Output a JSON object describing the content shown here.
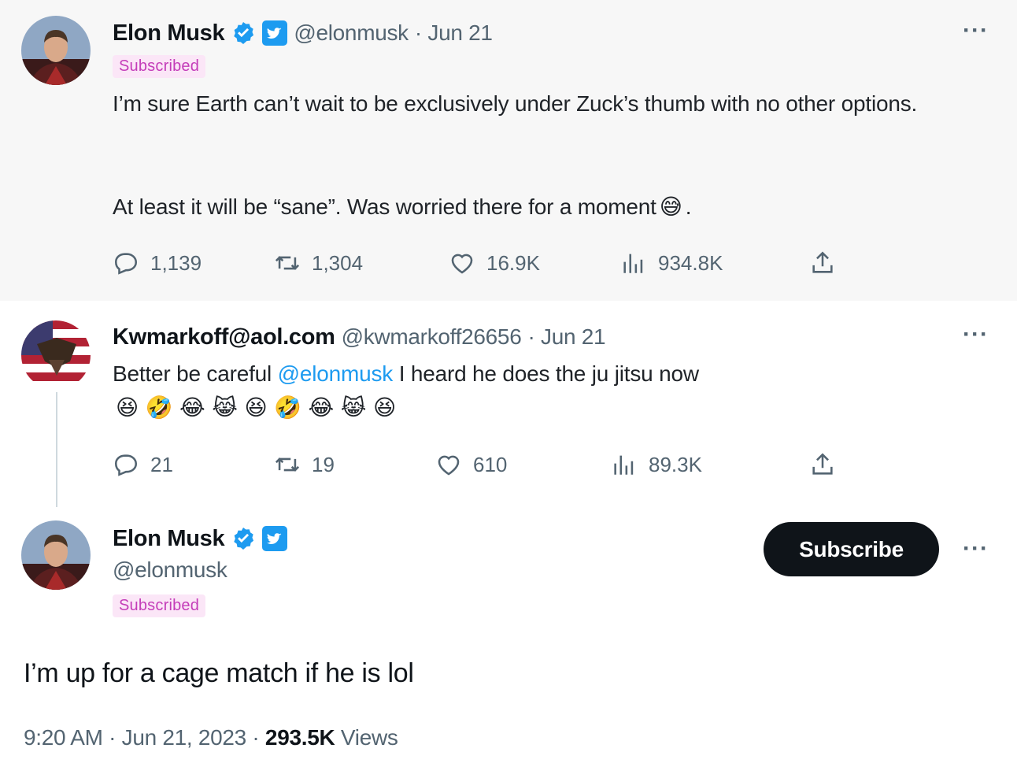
{
  "tweet1": {
    "name": "Elon Musk",
    "handle": "@elonmusk",
    "date": "· Jun 21",
    "subscribed": "Subscribed",
    "text_line1": "I’m sure Earth can’t wait to be exclusively under Zuck’s thumb with no other options.",
    "text_line2": "At least it will be “sane”. Was worried there for a moment",
    "text_end_emoji": "😅",
    "text_end": ".",
    "more": "···",
    "replies": "1,139",
    "retweets": "1,304",
    "likes": "16.9K",
    "views": "934.8K"
  },
  "tweet2": {
    "name": "Kwmarkoff@aol.com",
    "handle": "@kwmarkoff26656",
    "date": "· Jun 21",
    "text_before": "Better be careful ",
    "mention": "@elonmusk",
    "text_after": " I heard he does the ju jitsu now",
    "emojis": "😆 🤣 😂 😹 😆 🤣 😂 😹 😆",
    "more": "···",
    "replies": "21",
    "retweets": "19",
    "likes": "610",
    "views": "89.3K"
  },
  "tweet3": {
    "name": "Elon Musk",
    "handle": "@elonmusk",
    "subscribed": "Subscribed",
    "subscribe_button": "Subscribe",
    "more": "···",
    "text": "I’m up for a cage match if he is lol",
    "time": "9:20 AM · Jun 21, 2023 · ",
    "views_count": "293.5K",
    "views_label": " Views"
  },
  "icons": {
    "verified": "verified-check-icon",
    "twitter_badge": "twitter-bird-icon",
    "reply": "reply-icon",
    "retweet": "retweet-icon",
    "like": "heart-icon",
    "views": "bar-chart-icon",
    "share": "share-icon"
  },
  "colors": {
    "accent": "#1d9bf0",
    "subscribed_bg": "#fbe6f7",
    "subscribed_text": "#c43db9",
    "button_bg": "#0f1419"
  }
}
